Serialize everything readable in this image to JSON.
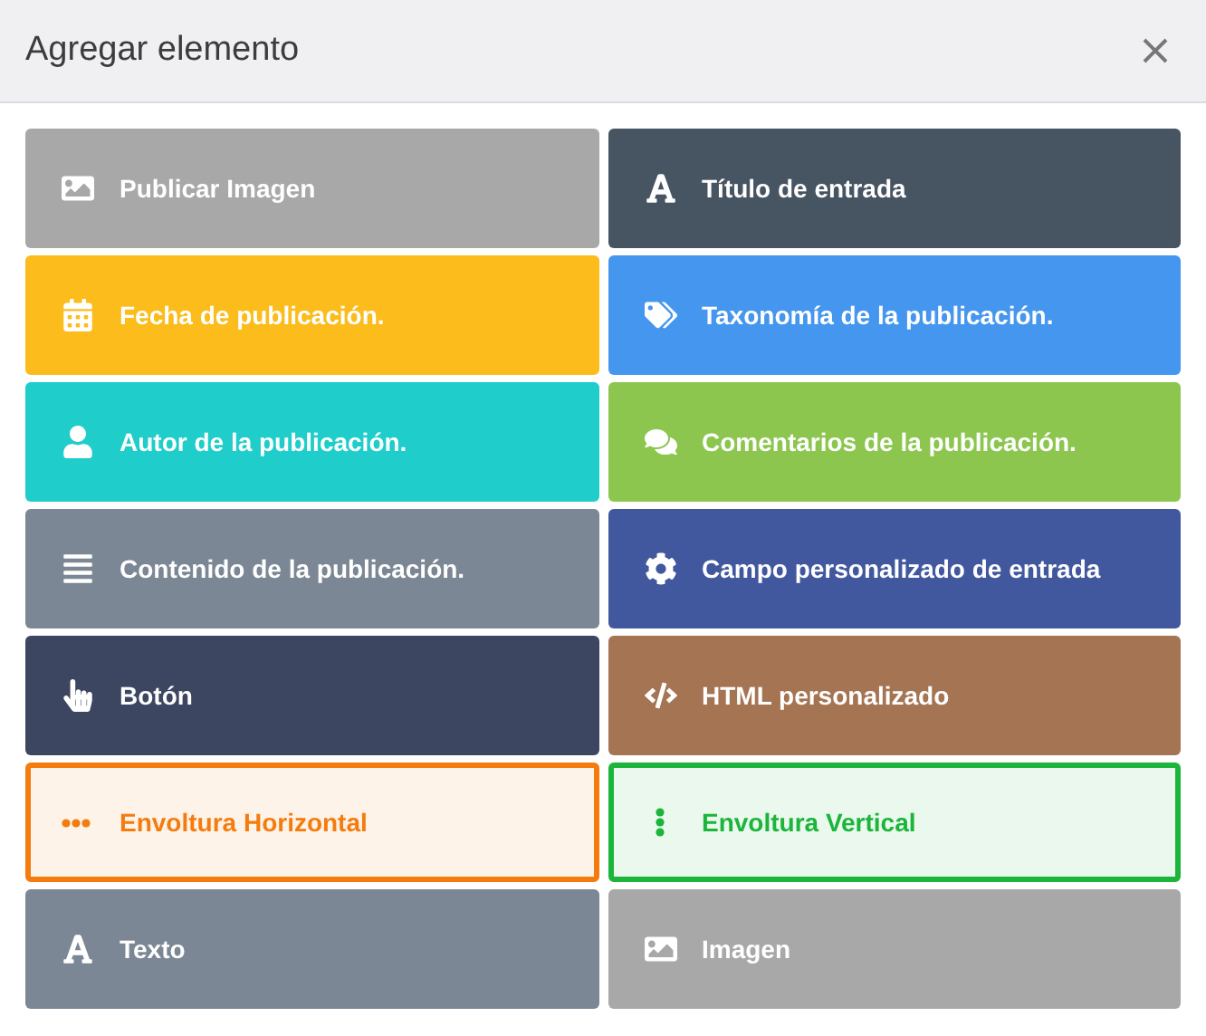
{
  "dialog": {
    "title": "Agregar elemento"
  },
  "items": [
    {
      "label": "Publicar Imagen",
      "kind": "solid",
      "color": "#a8a8a8"
    },
    {
      "label": "Título de entrada",
      "kind": "solid",
      "color": "#475462"
    },
    {
      "label": "Fecha de publicación.",
      "kind": "solid",
      "color": "#fbbc1c"
    },
    {
      "label": "Taxonomía de la publicación.",
      "kind": "solid",
      "color": "#4596ee"
    },
    {
      "label": "Autor de la publicación.",
      "kind": "solid",
      "color": "#1fcdca"
    },
    {
      "label": "Comentarios de la publicación.",
      "kind": "solid",
      "color": "#8cc64f"
    },
    {
      "label": "Contenido de la publicación.",
      "kind": "solid",
      "color": "#7b8794"
    },
    {
      "label": "Campo personalizado de entrada",
      "kind": "solid",
      "color": "#42589e"
    },
    {
      "label": "Botón",
      "kind": "solid",
      "color": "#3c4660"
    },
    {
      "label": "HTML personalizado",
      "kind": "solid",
      "color": "#a57453"
    },
    {
      "label": "Envoltura Horizontal",
      "kind": "outline",
      "color": "#f47c0f"
    },
    {
      "label": "Envoltura Vertical",
      "kind": "outline",
      "color": "#1cb53b"
    },
    {
      "label": "Texto",
      "kind": "solid",
      "color": "#7b8794"
    },
    {
      "label": "Imagen",
      "kind": "solid",
      "color": "#a8a8a8"
    }
  ]
}
